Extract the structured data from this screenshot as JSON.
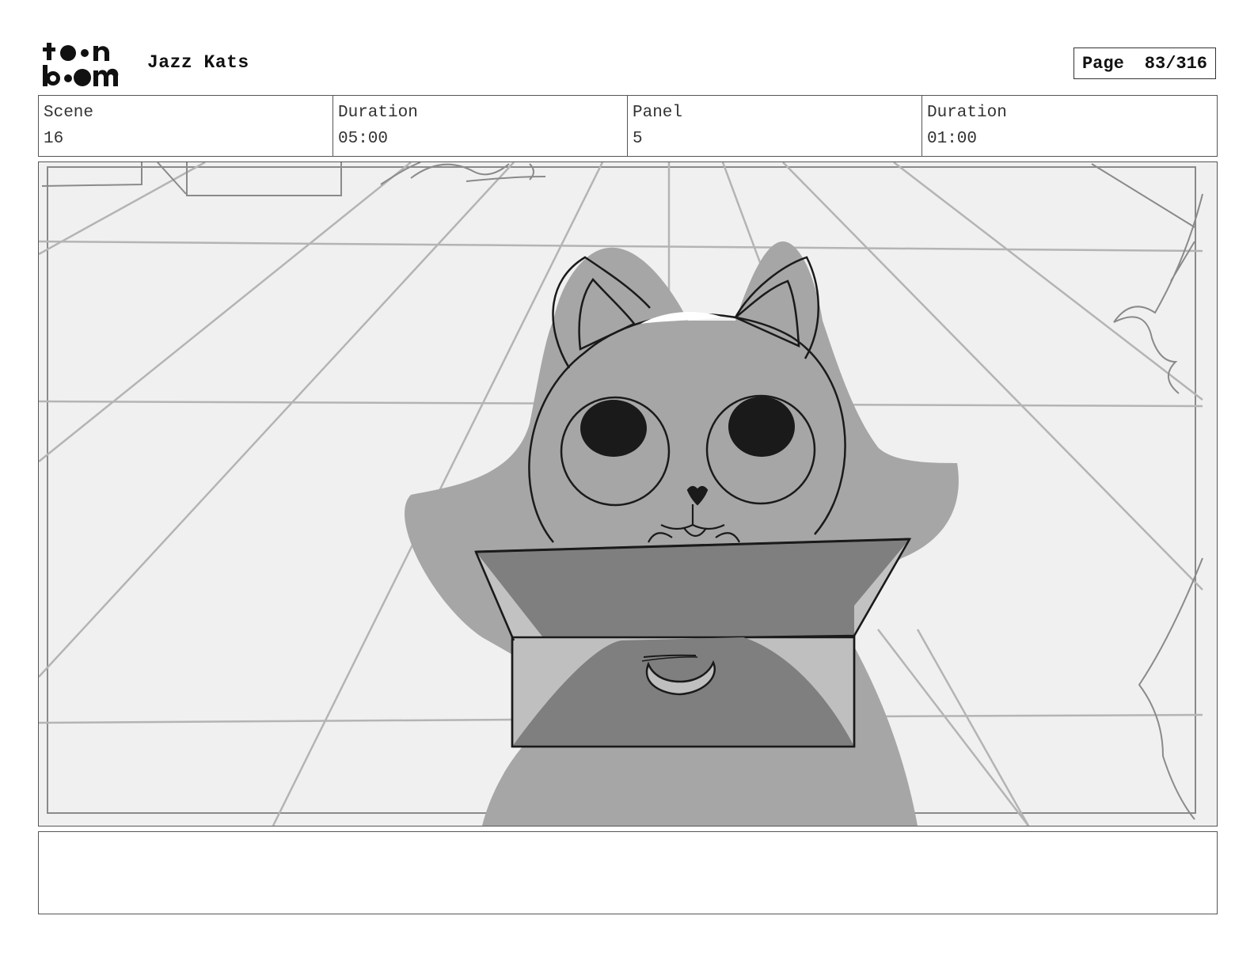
{
  "header": {
    "logo_text_top": "toon",
    "logo_text_bottom": "boom",
    "project_title": "Jazz Kats",
    "page_label": "Page",
    "page_value": "83/316"
  },
  "info": {
    "scene_label": "Scene",
    "scene_value": "16",
    "scene_duration_label": "Duration",
    "scene_duration_value": "05:00",
    "panel_label": "Panel",
    "panel_value": "5",
    "panel_duration_label": "Duration",
    "panel_duration_value": "01:00"
  },
  "panel": {
    "background_color": "#f0f0f0",
    "character_fill": "#a4a4a4",
    "box_fill": "#7f7f7f"
  },
  "notes": {
    "text": ""
  }
}
